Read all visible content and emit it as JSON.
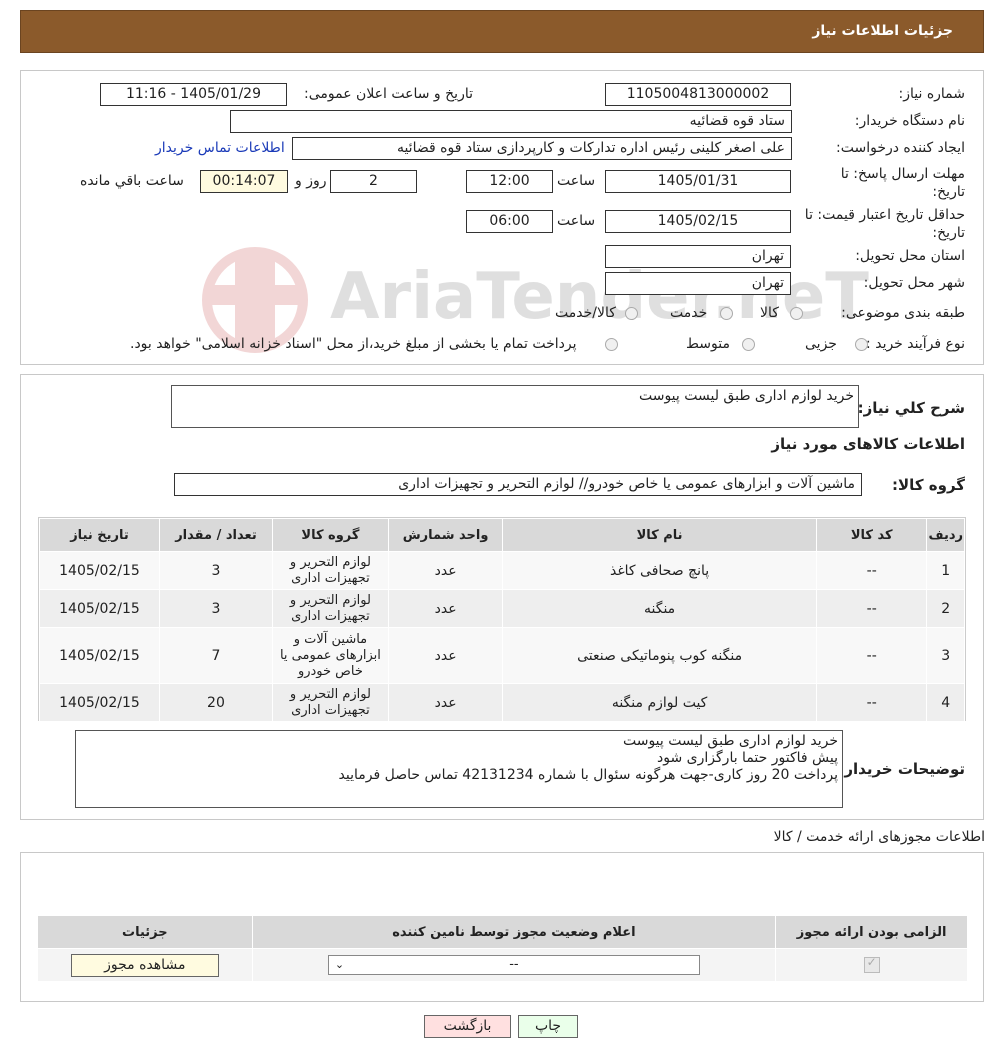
{
  "header": {
    "title": "جزئیات اطلاعات نیاز"
  },
  "form": {
    "need_number_label": "شماره نیاز:",
    "need_number": "1105004813000002",
    "announce_label": "تاریخ و ساعت اعلان عمومی:",
    "announce_value": "1405/01/29 - 11:16",
    "buyer_org_label": "نام دستگاه خریدار:",
    "buyer_org": "ستاد قوه قضائیه",
    "creator_label": "ایجاد کننده درخواست:",
    "creator": "علی اصغر کلینی رئیس اداره تدارکات و کارپردازی ستاد قوه قضائیه",
    "contact_link": "اطلاعات تماس خریدار",
    "deadline_label": "مهلت ارسال پاسخ: تا تاریخ:",
    "deadline_date": "1405/01/31",
    "time_label": "ساعت",
    "deadline_time": "12:00",
    "days_value": "2",
    "days_label": "روز و",
    "remaining_time": "00:14:07",
    "remaining_label": "ساعت باقي مانده",
    "validity_label": "حداقل تاریخ اعتبار قیمت: تا تاریخ:",
    "validity_date": "1405/02/15",
    "validity_time": "06:00",
    "province_label": "استان محل تحویل:",
    "province": "تهران",
    "city_label": "شهر محل تحویل:",
    "city": "تهران",
    "category_label": "طبقه بندی موضوعی:",
    "category_options": [
      "کالا",
      "خدمت",
      "کالا/خدمت"
    ],
    "process_label": "نوع فرآیند خرید :",
    "process_options": [
      "جزیی",
      "متوسط"
    ],
    "process_note": "پرداخت تمام یا بخشی از مبلغ خرید،از محل \"اسناد خزانه اسلامی\" خواهد بود."
  },
  "details": {
    "summary_label": "شرح کلي نياز:",
    "summary": "خرید لوازم اداری طبق لیست پیوست",
    "goods_info_title": "اطلاعات کالاهای مورد نیاز",
    "goods_group_label": "گروه کالا:",
    "goods_group": "ماشین آلات و ابزارهای عمومی یا خاص خودرو// لوازم التحریر و تجهیزات اداری",
    "table_headers": [
      "ردیف",
      "کد کالا",
      "نام کالا",
      "واحد شمارش",
      "گروه کالا",
      "تعداد / مقدار",
      "تاریخ نیاز"
    ],
    "rows": [
      {
        "idx": "1",
        "code": "--",
        "name": "پانچ صحافی کاغذ",
        "unit": "عدد",
        "group": "لوازم التحریر و تجهیزات اداری",
        "qty": "3",
        "date": "1405/02/15"
      },
      {
        "idx": "2",
        "code": "--",
        "name": "منگنه",
        "unit": "عدد",
        "group": "لوازم التحریر و تجهیزات اداری",
        "qty": "3",
        "date": "1405/02/15"
      },
      {
        "idx": "3",
        "code": "--",
        "name": "منگنه کوب پنوماتیکی صنعتی",
        "unit": "عدد",
        "group": "ماشین آلات و ابزارهای عمومی یا خاص خودرو",
        "qty": "7",
        "date": "1405/02/15"
      },
      {
        "idx": "4",
        "code": "--",
        "name": "کیت لوازم منگنه",
        "unit": "عدد",
        "group": "لوازم التحریر و تجهیزات اداری",
        "qty": "20",
        "date": "1405/02/15"
      }
    ],
    "buyer_notes_label": "توضیحات خریدار:",
    "buyer_notes_line1": "خرید لوازم اداری طبق لیست پیوست",
    "buyer_notes_line2": "پیش فاکتور حتما بارگزاری شود",
    "buyer_notes_line3": "پرداخت 20 روز کاری-جهت هرگونه سئوال با شماره 42131234 تماس حاصل فرمایید"
  },
  "licenses": {
    "title": "اطلاعات مجوزهای ارائه خدمت / کالا",
    "headers": [
      "الزامی بودن ارائه مجوز",
      "اعلام وضعیت مجوز توسط نامین کننده",
      "جزئیات"
    ],
    "select_value": "--",
    "view_button": "مشاهده مجوز"
  },
  "actions": {
    "print": "چاپ",
    "back": "بازگشت"
  },
  "watermark": "AriaTender.neT"
}
